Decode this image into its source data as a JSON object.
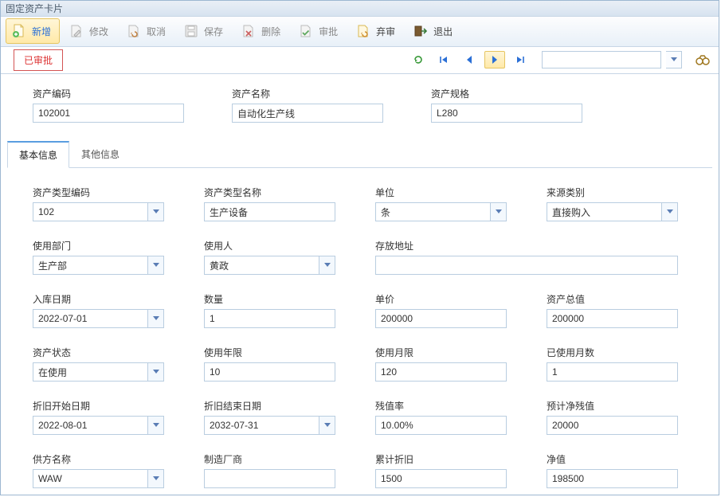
{
  "window": {
    "title": "固定资产卡片"
  },
  "toolbar": {
    "new": "新增",
    "modify": "修改",
    "cancel": "取消",
    "save": "保存",
    "delete": "删除",
    "approve": "审批",
    "unapprove": "弃审",
    "exit": "退出"
  },
  "status": "已审批",
  "header": {
    "code_label": "资产编码",
    "code": "102001",
    "name_label": "资产名称",
    "name": "自动化生产线",
    "spec_label": "资产规格",
    "spec": "L280"
  },
  "tabs": {
    "basic": "基本信息",
    "other": "其他信息"
  },
  "basic": {
    "type_code": {
      "label": "资产类型编码",
      "value": "102"
    },
    "type_name": {
      "label": "资产类型名称",
      "value": "生产设备"
    },
    "unit": {
      "label": "单位",
      "value": "条"
    },
    "source": {
      "label": "来源类别",
      "value": "直接购入"
    },
    "dept": {
      "label": "使用部门",
      "value": "生产部"
    },
    "user": {
      "label": "使用人",
      "value": "黄政"
    },
    "location": {
      "label": "存放地址",
      "value": ""
    },
    "in_date": {
      "label": "入库日期",
      "value": "2022-07-01"
    },
    "qty": {
      "label": "数量",
      "value": "1"
    },
    "price": {
      "label": "单价",
      "value": "200000"
    },
    "total": {
      "label": "资产总值",
      "value": "200000"
    },
    "state": {
      "label": "资产状态",
      "value": "在使用"
    },
    "years": {
      "label": "使用年限",
      "value": "10"
    },
    "months": {
      "label": "使用月限",
      "value": "120"
    },
    "used_months": {
      "label": "已使用月数",
      "value": "1"
    },
    "dep_start": {
      "label": "折旧开始日期",
      "value": "2022-08-01"
    },
    "dep_end": {
      "label": "折旧结束日期",
      "value": "2032-07-31"
    },
    "residual_rate": {
      "label": "残值率",
      "value": "10.00%"
    },
    "residual_est": {
      "label": "预计净残值",
      "value": "20000"
    },
    "supplier": {
      "label": "供方名称",
      "value": "WAW"
    },
    "mfr": {
      "label": "制造厂商",
      "value": ""
    },
    "acc_dep": {
      "label": "累计折旧",
      "value": "1500"
    },
    "net": {
      "label": "净值",
      "value": "198500"
    }
  }
}
